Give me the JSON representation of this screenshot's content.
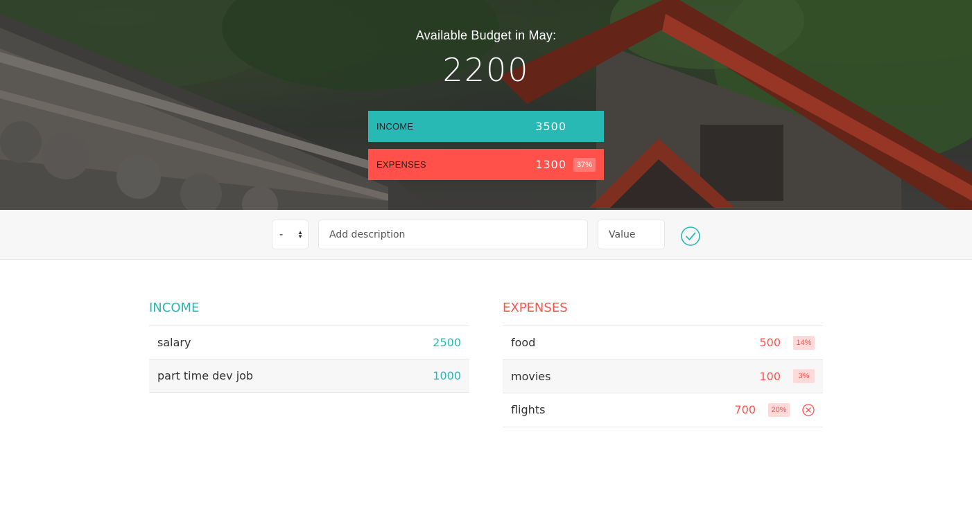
{
  "header": {
    "title": "Available Budget in May:",
    "budget": "2200",
    "income": {
      "label": "INCOME",
      "value": "3500"
    },
    "expenses": {
      "label": "EXPENSES",
      "value": "1300",
      "percentage": "37%"
    }
  },
  "add_form": {
    "type_selected": "-",
    "description_placeholder": "Add description",
    "value_placeholder": "Value",
    "submit_icon": "check-circle-icon"
  },
  "income_list": {
    "title": "INCOME",
    "items": [
      {
        "description": "salary",
        "value": "2500"
      },
      {
        "description": "part time dev job",
        "value": "1000"
      }
    ]
  },
  "expenses_list": {
    "title": "EXPENSES",
    "items": [
      {
        "description": "food",
        "value": "500",
        "percentage": "14%"
      },
      {
        "description": "movies",
        "value": "100",
        "percentage": "3%"
      },
      {
        "description": "flights",
        "value": "700",
        "percentage": "20%"
      }
    ],
    "delete_icon": "close-circle-icon"
  },
  "colors": {
    "income": "#28b9b5",
    "expenses": "#ff5049",
    "percentage_bg": "#ffdad9"
  }
}
